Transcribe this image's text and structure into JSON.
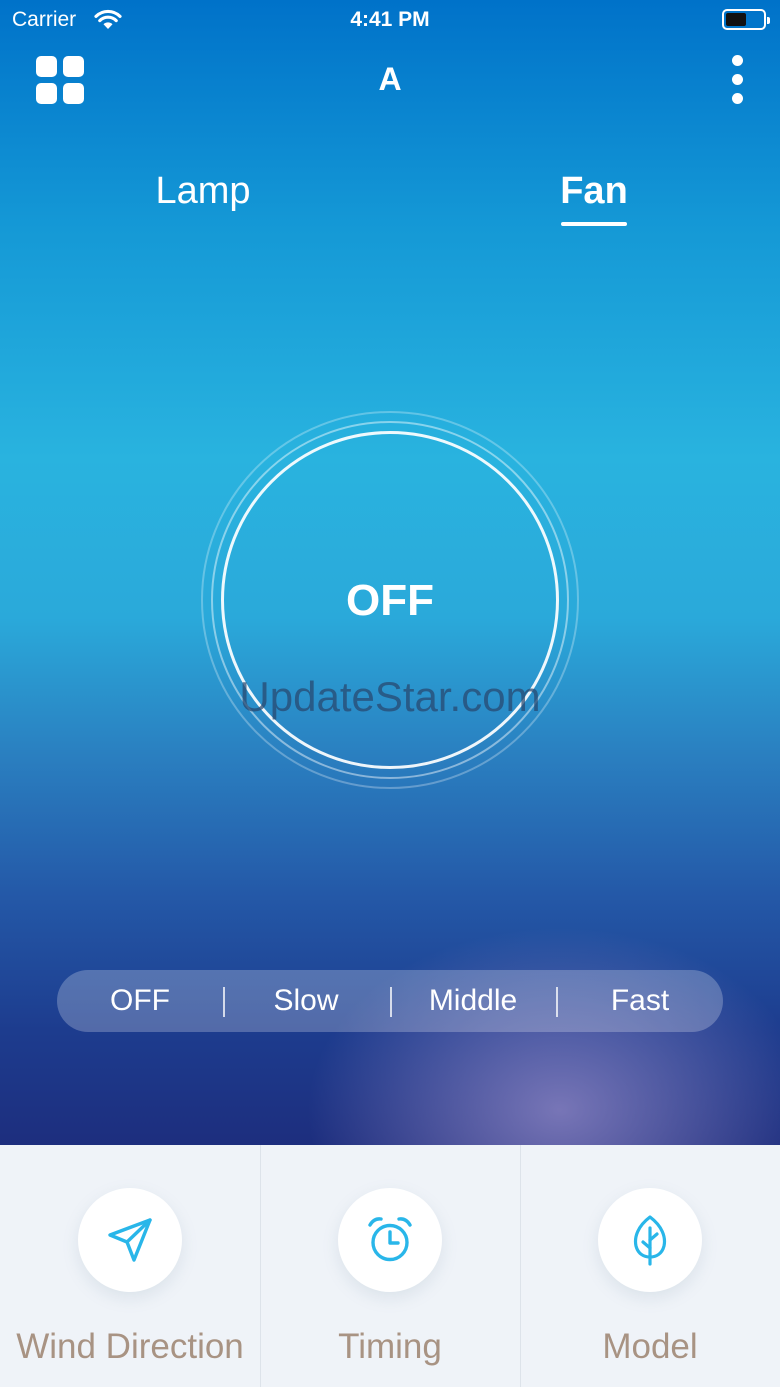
{
  "status_bar": {
    "carrier": "Carrier",
    "time": "4:41 PM"
  },
  "nav": {
    "title": "A"
  },
  "tabs": [
    {
      "label": "Lamp",
      "active": false
    },
    {
      "label": "Fan",
      "active": true
    }
  ],
  "power": {
    "state_label": "OFF"
  },
  "watermark": "UpdateStar.com",
  "speed": {
    "options": [
      "OFF",
      "Slow",
      "Middle",
      "Fast"
    ],
    "selected": "OFF"
  },
  "bottom_actions": [
    {
      "label": "Wind Direction",
      "icon": "send-icon"
    },
    {
      "label": "Timing",
      "icon": "alarm-clock-icon"
    },
    {
      "label": "Model",
      "icon": "leaf-icon"
    }
  ],
  "colors": {
    "accent": "#29b6e9",
    "label": "#a89383"
  }
}
